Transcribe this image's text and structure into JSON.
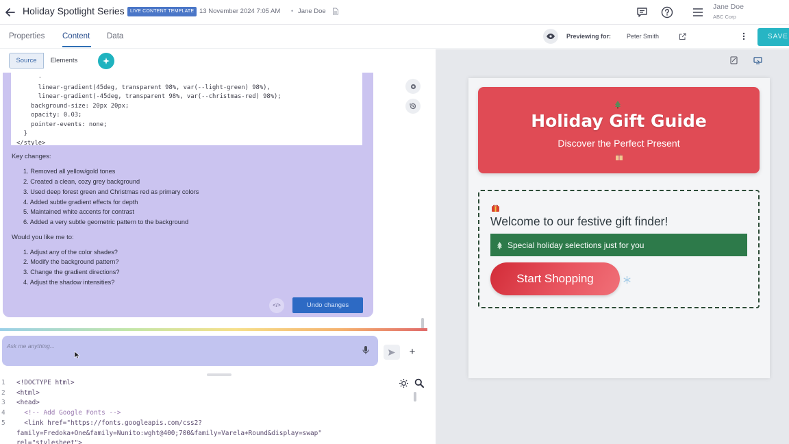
{
  "header": {
    "title": "Holiday Spotlight Series",
    "badge": "LIVE CONTENT TEMPLATE",
    "timestamp": "13 November 2024 7:05 AM",
    "separator": "•",
    "author": "Jane Doe",
    "user_name": "Jane Doe",
    "user_org": "ABC Corp"
  },
  "tabs": {
    "properties": "Properties",
    "content": "Content",
    "data": "Data"
  },
  "preview": {
    "label": "Previewing for:",
    "name": "Peter Smith"
  },
  "save_label": "SAVE",
  "editor_mode": {
    "source": "Source",
    "elements": "Elements"
  },
  "chat": {
    "code_lines": [
      "      ·",
      "      linear-gradient(45deg, transparent 98%, var(--light-green) 98%),",
      "      linear-gradient(-45deg, transparent 98%, var(--christmas-red) 98%);",
      "    background-size: 20px 20px;",
      "    opacity: 0.03;",
      "    pointer-events: none;",
      "  }",
      "</style>"
    ],
    "key_changes_heading": "Key changes:",
    "key_changes": [
      "1. Removed all yellow/gold tones",
      "2. Created a clean, cozy grey background",
      "3. Used deep forest green and Christmas red as primary colors",
      "4. Added subtle gradient effects for depth",
      "5. Maintained white accents for contrast",
      "6. Added a very subtle geometric pattern to the background"
    ],
    "question_heading": "Would you like me to:",
    "questions": [
      "1. Adjust any of the color shades?",
      "2. Modify the background pattern?",
      "3. Change the gradient directions?",
      "4. Adjust the shadow intensities?"
    ],
    "code_toggle": "</>",
    "undo_label": "Undo changes",
    "input_placeholder": "Ask me anything..."
  },
  "editor": {
    "lines": [
      {
        "num": "1",
        "text": "<!DOCTYPE html>"
      },
      {
        "num": "2",
        "text": "<html>"
      },
      {
        "num": "3",
        "text": "<head>"
      },
      {
        "num": "4",
        "text": "  <!-- Add Google Fonts -->"
      },
      {
        "num": "5",
        "text": "  <link href=\"https://fonts.googleapis.com/css2?"
      },
      {
        "num": "",
        "text": "family=Fredoka+One&family=Nunito:wght@400;700&family=Varela+Round&display=swap\""
      },
      {
        "num": "",
        "text": "rel=\"stylesheet\">"
      }
    ]
  },
  "preview_page": {
    "hero_title": "Holiday Gift Guide",
    "hero_subtitle": "Discover the Perfect Present",
    "welcome": "Welcome to our festive gift finder!",
    "banner": "Special holiday selections just for you",
    "cta": "Start Shopping"
  },
  "colors": {
    "accent": "#27b5c4",
    "primary_blue": "#2d6ac4",
    "christmas_red": "#e04b55",
    "forest_green": "#2d7a4a",
    "chat_bg": "#cbc4f0"
  },
  "icons": [
    "back-arrow-icon",
    "document-icon",
    "chat-icon",
    "help-icon",
    "menu-icon",
    "eye-icon",
    "external-link-icon",
    "kebab-icon",
    "ai-sparkle-icon",
    "settings-icon",
    "history-icon",
    "mic-icon",
    "send-icon",
    "plus-icon",
    "theme-icon",
    "search-icon",
    "code-icon",
    "tree-icon",
    "gift-icon",
    "snowflake-icon"
  ]
}
